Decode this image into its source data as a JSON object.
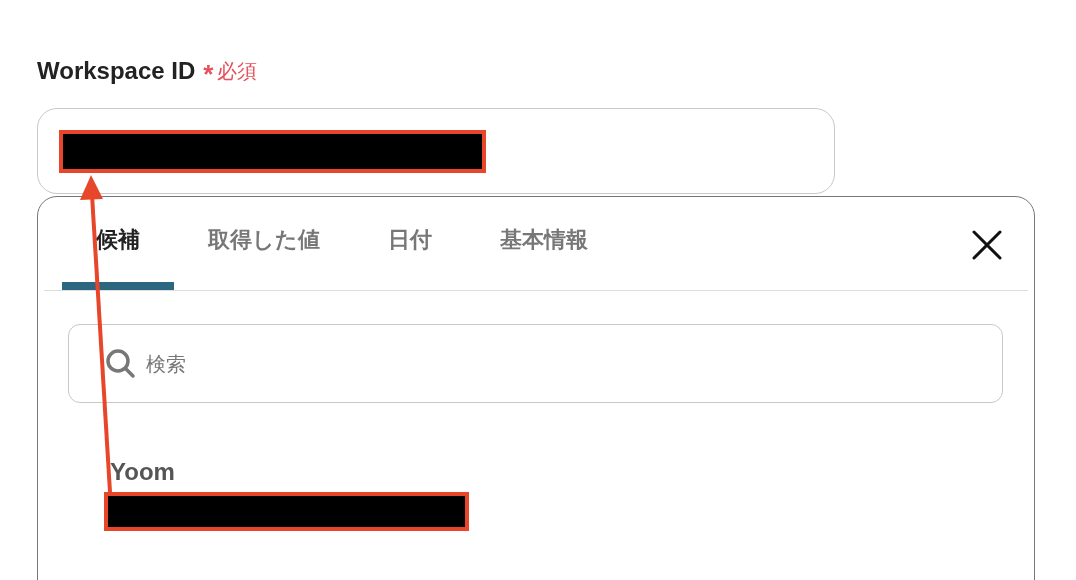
{
  "field": {
    "label": "Workspace ID",
    "required_mark": "*",
    "required_text": "必須",
    "value_redacted": true
  },
  "picker": {
    "tabs": [
      {
        "label": "候補",
        "selected": true
      },
      {
        "label": "取得した値",
        "selected": false
      },
      {
        "label": "日付",
        "selected": false
      },
      {
        "label": "基本情報",
        "selected": false
      }
    ],
    "search": {
      "placeholder": "検索"
    },
    "candidates": [
      {
        "name": "Yoom",
        "value_redacted": true
      }
    ]
  }
}
